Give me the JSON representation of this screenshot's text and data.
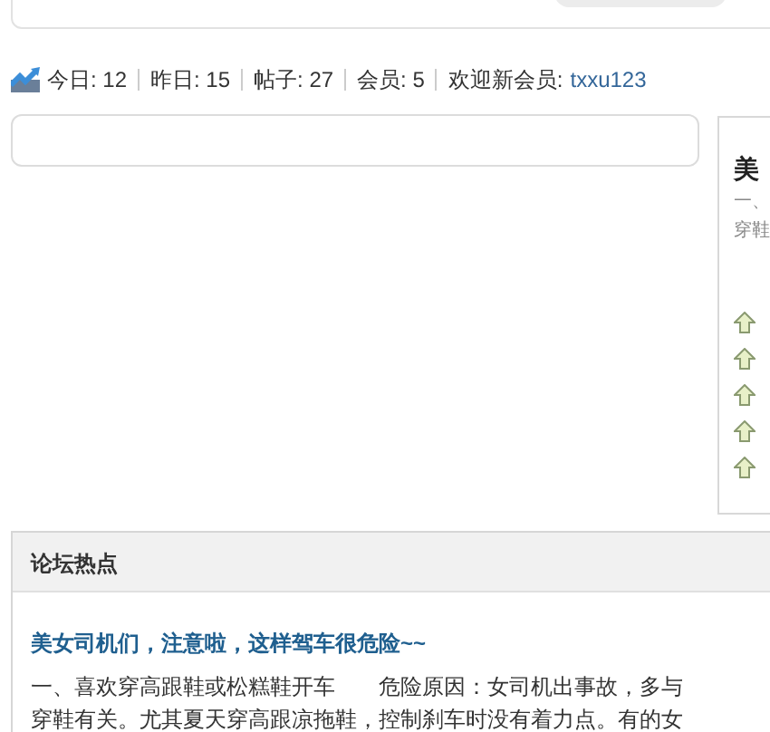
{
  "stats": [
    {
      "label": "今日:",
      "value": "12"
    },
    {
      "label": "昨日:",
      "value": "15"
    },
    {
      "label": "帖子:",
      "value": "27"
    },
    {
      "label": "会员:",
      "value": "5"
    }
  ],
  "welcome": {
    "label": "欢迎新会员:",
    "member": "txxu123"
  },
  "side_panel": {
    "title": "美",
    "lines": [
      "一、",
      "穿鞋"
    ],
    "arrows": [
      {
        "kind": "up"
      },
      {
        "kind": "up"
      },
      {
        "kind": "up"
      },
      {
        "kind": "up"
      },
      {
        "kind": "up"
      }
    ]
  },
  "hot": {
    "heading": "论坛热点",
    "post_title": "美女司机们，注意啦，这样驾车很危险~~",
    "excerpt": "一、喜欢穿高跟鞋或松糕鞋开车　　危险原因：女司机出事故，多与穿鞋有关。尤其夏天穿高跟凉拖鞋，控制刹车时没有着力点。有的女"
  }
}
